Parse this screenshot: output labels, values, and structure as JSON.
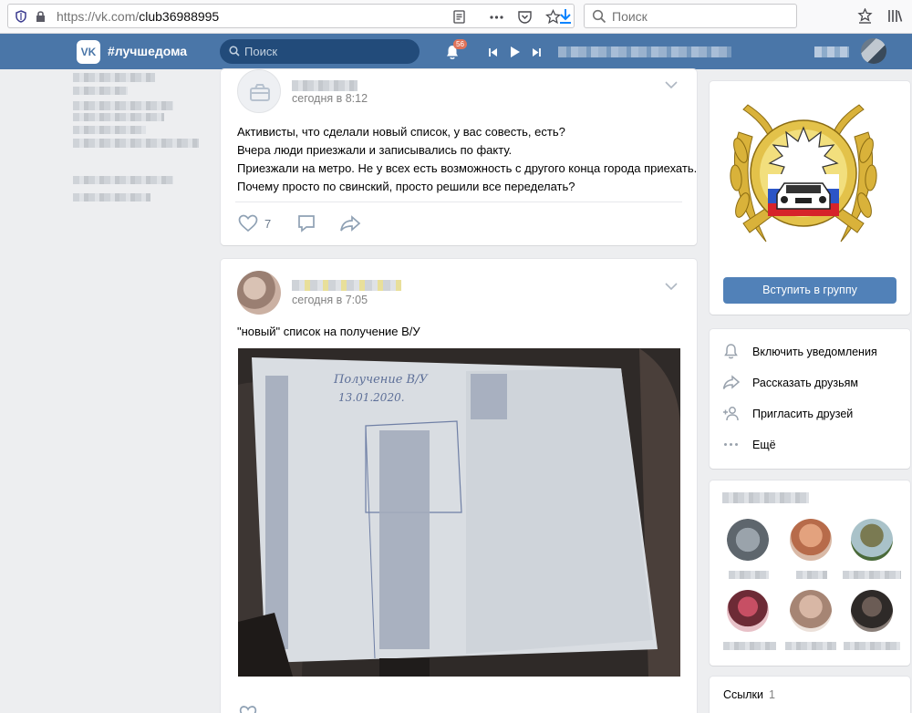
{
  "browser": {
    "url_host": "https://vk.com/",
    "url_path": "club36988995",
    "search_placeholder": "Поиск"
  },
  "header": {
    "group_tag": "#лучшедома",
    "search_placeholder": "Поиск",
    "notifications_count": "56"
  },
  "posts": [
    {
      "time": "сегодня в 8:12",
      "lines": [
        "Активисты, что сделали новый список, у вас совесть, есть?",
        "Вчера люди приезжали и записывались по факту.",
        "Приезжали на метро. Не у всех есть возможность с другого конца города приехать.",
        "Почему просто по свинский, просто решили все переделать?"
      ],
      "likes": "7"
    },
    {
      "time": "сегодня в 7:05",
      "text": "\"новый\" список на получение В/У",
      "photo_title": "Получение В/У",
      "photo_date": "13.01.2020."
    }
  ],
  "sidebar": {
    "join_button": "Вступить в группу",
    "menu": [
      {
        "label": "Включить уведомления",
        "icon": "bell-icon"
      },
      {
        "label": "Рассказать друзьям",
        "icon": "share-icon"
      },
      {
        "label": "Пригласить друзей",
        "icon": "add-friend-icon"
      },
      {
        "label": "Ещё",
        "icon": "more-icon"
      }
    ],
    "links_title": "Ссылки",
    "links_count": "1"
  },
  "colors": {
    "vk_blue": "#4a76a8",
    "button_blue": "#5181b8",
    "page_bg": "#edeef0"
  }
}
